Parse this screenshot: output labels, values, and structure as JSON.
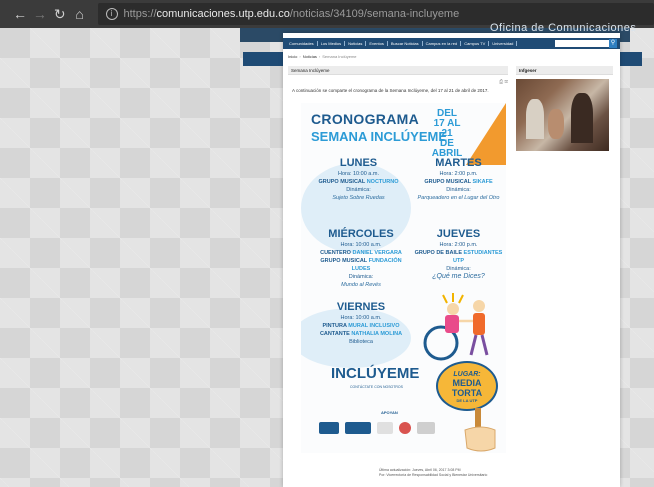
{
  "browser": {
    "url_prefix": "https://",
    "url_host": "comunicaciones.utp.edu.co",
    "url_path": "/noticias/34109/semana-incluyeme"
  },
  "site": {
    "office_title": "Oficina de Comunicaciones",
    "menu": [
      "Comunidades",
      "Los Medios",
      "Noticias",
      "Eventos",
      "Buscar Noticias",
      "Campus en la red",
      "Campus TV",
      "Universidad"
    ],
    "breadcrumb": [
      "Inicio",
      "Noticias",
      "Semana Inclúyeme"
    ],
    "search_icon": "search-icon"
  },
  "article": {
    "heading": "Semana Inclúyeme",
    "intro": "A continuación se comparte el cronograma de la Semana Inclúyeme, del 17 al 21 de abril de 2017.",
    "footer_line1": "Última actualización: Jueves, Abril 06, 2017 3:08 PM",
    "footer_line2": "Por: Vicerrectoría de Responsabilidad Social y Bienestar Universitario"
  },
  "poster": {
    "title": "CRONOGRAMA",
    "subtitle": "SEMANA INCLÚYEME",
    "dates": [
      "DEL",
      "17 AL 21",
      "DE ABRIL"
    ],
    "days": {
      "lunes": {
        "name": "LUNES",
        "hora": "Hora: 10:00 a.m.",
        "act_prefix": "GRUPO MUSICAL",
        "act_hl": "NOCTURNO",
        "din": "Dinámica:",
        "din_text": "Sujeto Sobre Ruedas"
      },
      "martes": {
        "name": "MARTES",
        "hora": "Hora: 2:00 p.m.",
        "act_prefix": "GRUPO MUSICAL",
        "act_hl": "SIKAFE",
        "din": "Dinámica:",
        "din_text": "Parqueadero en el Lugar del Otro"
      },
      "miercoles": {
        "name": "MIÉRCOLES",
        "hora": "Hora: 10:00 a.m.",
        "act1_prefix": "CUENTERO",
        "act1_hl": "DANIEL VERGARA",
        "act2_prefix": "GRUPO MUSICAL",
        "act2_hl": "FUNDACIÓN LUDES",
        "din": "Dinámica:",
        "din_text": "Mundo al Revés"
      },
      "jueves": {
        "name": "JUEVES",
        "hora": "Hora: 2:00 p.m.",
        "act_prefix": "GRUPO DE BAILE",
        "act_hl": "ESTUDIANTES UTP",
        "din": "Dinámica:",
        "din_text": "¿Qué me Dices?"
      },
      "viernes": {
        "name": "VIERNES",
        "hora": "Hora: 10:00 a.m.",
        "act1_prefix": "PINTURA",
        "act1_hl": "MURAL INCLUSIVO",
        "act2_prefix": "CANTANTE",
        "act2_hl": "NATHALIA MOLINA",
        "place": "Biblioteca"
      }
    },
    "logo_word": "INCLÚYEME",
    "logo_sub": "CONTÁCTATE CON NOSOTROS",
    "lugar_label": "LUGAR:",
    "lugar_place": "MEDIA TORTA",
    "lugar_utp": "DE LA UTP",
    "apoyan": "APOYAN",
    "colors": {
      "blue": "#1e5b8f",
      "light_blue": "#2c9bd6",
      "orange": "#f29a2e",
      "yellow": "#f6b738"
    }
  },
  "sidebar": {
    "heading": "Infgeser"
  }
}
